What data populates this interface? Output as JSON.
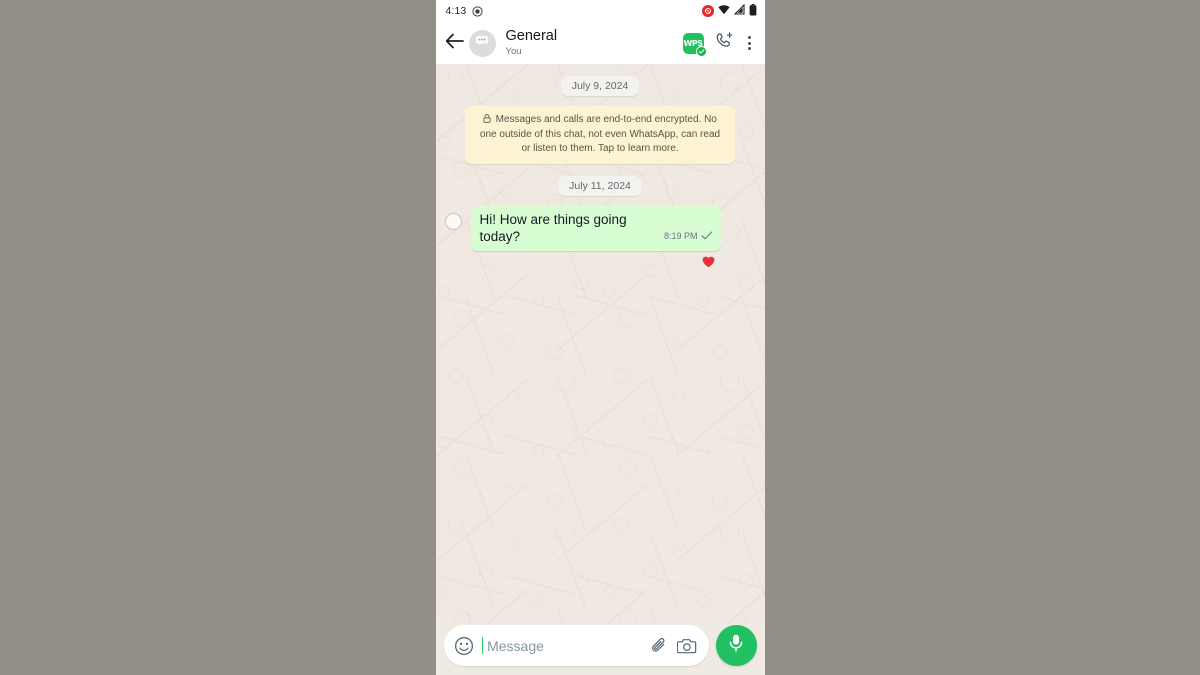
{
  "status_bar": {
    "time": "4:13",
    "recording_icon": "screen-record-icon",
    "notification_badge": "notification-badge-icon",
    "wifi_icon": "wifi-icon",
    "signal_icon": "cellular-signal-icon",
    "battery_icon": "battery-icon"
  },
  "header": {
    "back_icon": "back-arrow-icon",
    "avatar_icon": "group-chat-avatar-icon",
    "title": "General",
    "subtitle": "You",
    "app_badge": {
      "name": "wps-app-badge-icon",
      "glyph": "WPS",
      "verified_check": "✓"
    },
    "add_call_icon": "add-call-icon",
    "overflow_icon": "overflow-menu-icon"
  },
  "chat": {
    "date_divider_1": "July 9, 2024",
    "encryption_notice": "Messages and calls are end-to-end encrypted. No one outside of this chat, not even WhatsApp, can read or listen to them. Tap to learn more.",
    "encryption_lock_icon": "lock-icon",
    "date_divider_2": "July 11, 2024",
    "messages": [
      {
        "text": "Hi! How are things going today?",
        "time": "8:19 PM",
        "status_icon": "single-check-icon",
        "reaction": "❤️",
        "selected": false,
        "outgoing": true
      }
    ]
  },
  "composer": {
    "emoji_icon": "emoji-icon",
    "placeholder": "Message",
    "attach_icon": "paperclip-icon",
    "camera_icon": "camera-icon",
    "mic_icon": "microphone-icon"
  },
  "colors": {
    "backdrop": "#938f87",
    "chat_bg": "#efe9e1",
    "outgoing_bubble": "#d9fdd3",
    "encryption_bg": "#fdf3d2",
    "accent_green": "#21c063",
    "badge_red": "#e8262a"
  }
}
